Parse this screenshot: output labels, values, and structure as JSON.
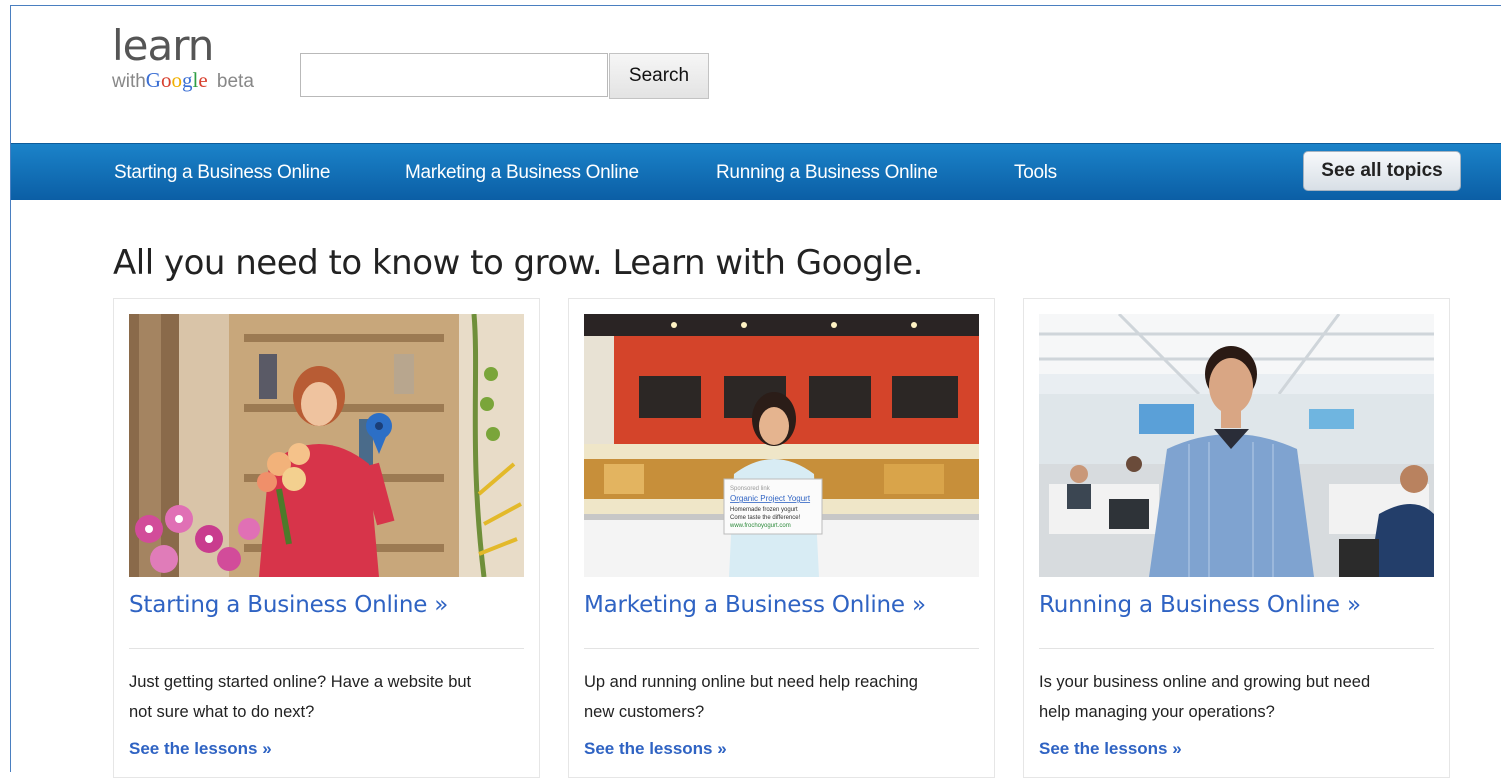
{
  "logo": {
    "learn": "learn",
    "with": "with",
    "google": [
      "G",
      "o",
      "o",
      "g",
      "l",
      "e"
    ],
    "beta": "beta"
  },
  "search": {
    "value": "",
    "placeholder": "",
    "button_label": "Search"
  },
  "nav": {
    "items": [
      "Starting a Business Online",
      "Marketing a Business Online",
      "Running a Business Online",
      "Tools"
    ],
    "see_all": "See all topics"
  },
  "headline": "All you need to know to grow. Learn with Google.",
  "cards": [
    {
      "title": "Starting a Business Online »",
      "desc_1": "Just getting started online? Have a website but",
      "desc_2": "not sure what to do next?",
      "link": "See the lessons »"
    },
    {
      "title": "Marketing a Business Online »",
      "desc_1": "Up and running online but need help reaching",
      "desc_2": "new customers?",
      "link": "See the lessons »",
      "sign_lines": [
        "Sponsored link",
        "Organic Project Yogurt",
        "Homemade frozen yogurt",
        "Come taste the difference!",
        "www.frochoyogurt.com"
      ]
    },
    {
      "title": "Running a Business Online »",
      "desc_1": "Is your business online and growing but need",
      "desc_2": "help managing your operations?",
      "link": "See the lessons »"
    }
  ],
  "colors": {
    "nav": "#0f6db5",
    "link": "#2f63c3",
    "text": "#222222"
  }
}
